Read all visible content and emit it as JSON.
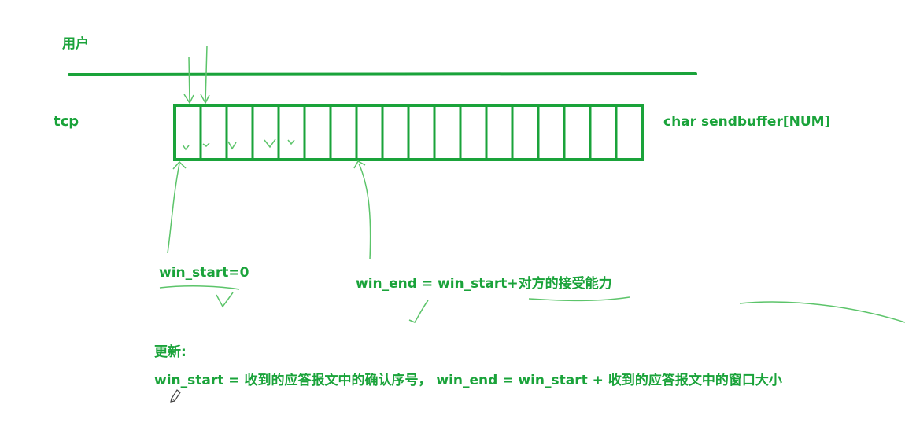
{
  "labels": {
    "user": "用户",
    "tcp": "tcp",
    "buffer": "char sendbuffer[NUM]",
    "win_start": "win_start=0",
    "win_end": "win_end = win_start+对方的接受能力",
    "update_title": "更新:",
    "update_formula": "win_start = 收到的应答报文中的确认序号， win_end = win_start + 收到的应答报文中的窗口大小"
  },
  "colors": {
    "ink_dark": "#1aa33a",
    "ink_light": "#5cc46a"
  },
  "buffer": {
    "cell_count": 18,
    "marked_cells": 5
  }
}
